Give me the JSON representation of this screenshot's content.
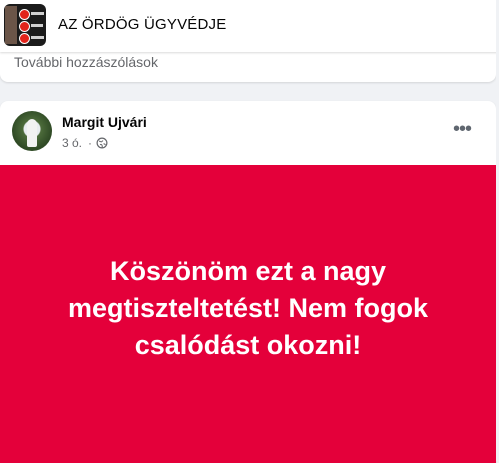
{
  "header": {
    "group_name": "AZ ÖRDÖG ÜGYVÉDJE"
  },
  "previous_post": {
    "more_comments_label": "További hozzászólások"
  },
  "post": {
    "author": "Margit Ujvári",
    "time": "3 ó.",
    "separator": "·",
    "audience_icon": "globe-icon",
    "more_icon": "more-horizontal-icon",
    "text": "Köszönöm ezt a nagy megtiszteltetést! Nem fogok csalódást okozni!",
    "background_color": "#e4003a",
    "text_color": "#ffffff"
  }
}
